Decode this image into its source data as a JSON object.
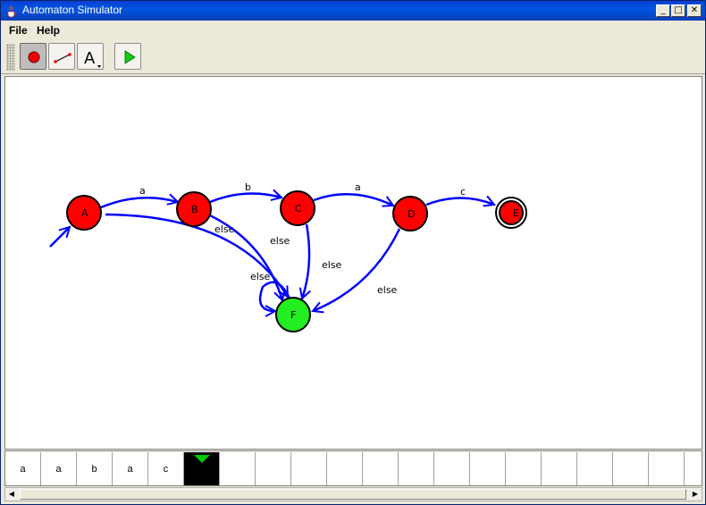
{
  "window": {
    "title": "Automaton Simulator",
    "minimize": "_",
    "maximize": "□",
    "close": "✕"
  },
  "menu": {
    "items": [
      "File",
      "Help"
    ]
  },
  "toolbar": {
    "tools": [
      {
        "name": "add-state-tool",
        "active": true
      },
      {
        "name": "add-transition-tool",
        "active": false
      },
      {
        "name": "text-tool",
        "label": "A",
        "active": false
      },
      {
        "name": "run-tool",
        "active": false
      }
    ]
  },
  "automaton": {
    "states": [
      {
        "id": "A",
        "label": "A",
        "color": "#ff0000",
        "accepting": false,
        "initial": true
      },
      {
        "id": "B",
        "label": "B",
        "color": "#ff0000",
        "accepting": false
      },
      {
        "id": "C",
        "label": "C",
        "color": "#ff0000",
        "accepting": false
      },
      {
        "id": "D",
        "label": "D",
        "color": "#ff0000",
        "accepting": false
      },
      {
        "id": "E",
        "label": "E",
        "color": "#ff0000",
        "accepting": true
      },
      {
        "id": "F",
        "label": "F",
        "color": "#22ee22",
        "accepting": false
      }
    ],
    "transitions": [
      {
        "from": "A",
        "to": "B",
        "label": "a"
      },
      {
        "from": "B",
        "to": "C",
        "label": "b"
      },
      {
        "from": "C",
        "to": "D",
        "label": "a"
      },
      {
        "from": "D",
        "to": "E",
        "label": "c"
      },
      {
        "from": "A",
        "to": "F",
        "label": "else"
      },
      {
        "from": "B",
        "to": "F",
        "label": "else"
      },
      {
        "from": "C",
        "to": "F",
        "label": "else"
      },
      {
        "from": "D",
        "to": "F",
        "label": "else"
      },
      {
        "from": "F",
        "to": "F",
        "label": "else"
      }
    ],
    "edge_color": "#0000ff"
  },
  "tape": {
    "cells": [
      "a",
      "a",
      "b",
      "a",
      "c",
      "",
      "",
      "",
      "",
      "",
      "",
      "",
      "",
      "",
      "",
      "",
      "",
      "",
      "",
      ""
    ],
    "head_index": 5,
    "head_color": "#00cc00"
  }
}
